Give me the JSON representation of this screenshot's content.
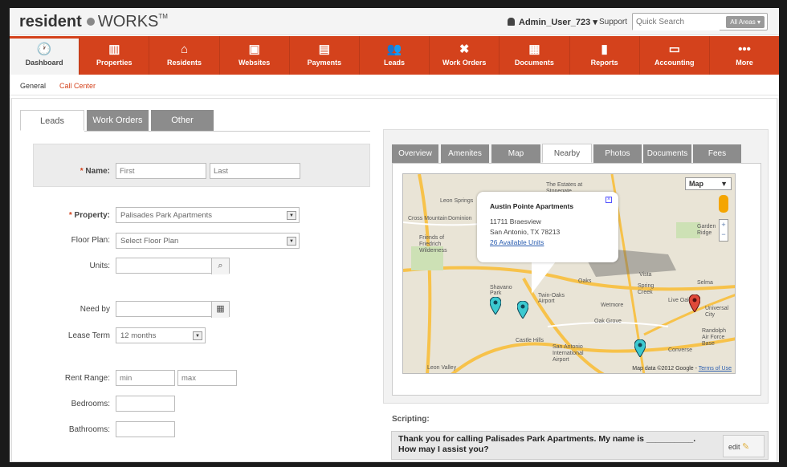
{
  "header": {
    "logo_bold": "resident",
    "logo_light": "WORKS",
    "logo_tm": "TM",
    "user": "Admin_User_723 ▾",
    "support": "Support",
    "search_placeholder": "Quick Search",
    "search_scope": "All Areas ▾"
  },
  "nav": [
    {
      "label": "Dashboard",
      "icon": "🕐"
    },
    {
      "label": "Properties",
      "icon": "▥"
    },
    {
      "label": "Residents",
      "icon": "⌂"
    },
    {
      "label": "Websites",
      "icon": "▣"
    },
    {
      "label": "Payments",
      "icon": "▤"
    },
    {
      "label": "Leads",
      "icon": "👥"
    },
    {
      "label": "Work Orders",
      "icon": "✖"
    },
    {
      "label": "Documents",
      "icon": "▦"
    },
    {
      "label": "Reports",
      "icon": "▮"
    },
    {
      "label": "Accounting",
      "icon": "▭"
    },
    {
      "label": "More",
      "icon": "•••"
    }
  ],
  "subnav": {
    "general": "General",
    "call_center": "Call Center"
  },
  "left_tabs": [
    "Leads",
    "Work Orders",
    "Other"
  ],
  "form": {
    "name_label": "Name:",
    "first_ph": "First",
    "last_ph": "Last",
    "property_label": "Property:",
    "property_value": "Palisades Park Apartments",
    "floorplan_label": "Floor Plan:",
    "floorplan_value": "Select Floor Plan",
    "units_label": "Units:",
    "needby_label": "Need by",
    "leaseterm_label": "Lease Term",
    "leaseterm_value": "12 months",
    "rentrange_label": "Rent Range:",
    "min_ph": "min",
    "max_ph": "max",
    "bedrooms_label": "Bedrooms:",
    "bathrooms_label": "Bathrooms:"
  },
  "right_tabs": [
    "Overview",
    "Amenites",
    "Map",
    "Nearby",
    "Photos",
    "Documents",
    "Fees"
  ],
  "map": {
    "type_label": "Map",
    "popup_title": "Austin Pointe Apartments",
    "popup_addr1": "11711 Braesview",
    "popup_addr2": "San Antonio, TX 78213",
    "popup_link": "26 Available Units",
    "footer": "Map data ©2012 Google -",
    "terms": "Terms of Use",
    "places": [
      "Leon Springs",
      "Cross Mountain",
      "Dominion",
      "Friends of Friedrich Wilderness",
      "Shavano Park",
      "Twin-Oaks Airport",
      "Castle Hills",
      "San Antonio International Airport",
      "Leon Valley",
      "Oak Grove",
      "Wetmore",
      "Converse",
      "Live Oak",
      "Universal City",
      "Selma",
      "Garden Ridge",
      "Randolph Air Force Base",
      "Spring Creek",
      "The Estates at Stonegate",
      "Vista",
      "Oaks"
    ]
  },
  "scripting": {
    "label": "Scripting:",
    "text": "Thank you for calling Palisades Park Apartments.  My name is __________.  How may I assist you?",
    "edit": "edit"
  }
}
